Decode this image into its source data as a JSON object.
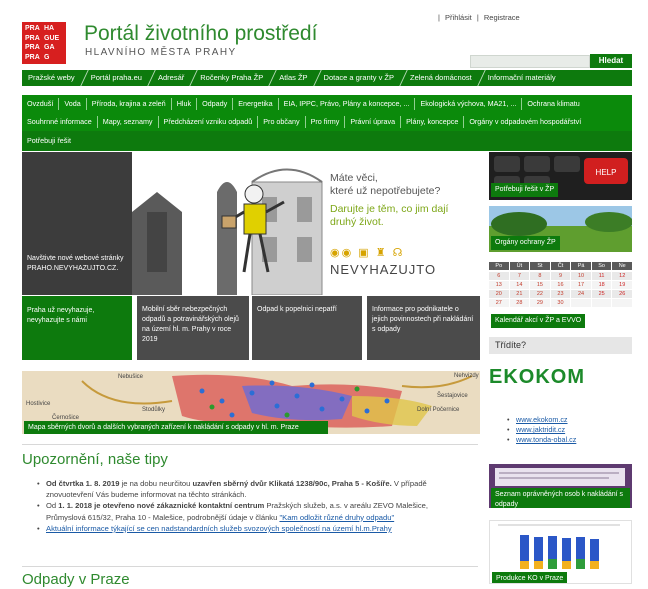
{
  "header": {
    "logo_lines": [
      "PRA",
      "HA",
      "PRA",
      "GUE",
      "PRA",
      "GA",
      "PRA",
      "G"
    ],
    "title": "Portál životního prostředí",
    "subtitle": "HLAVNÍHO MĚSTA PRAHY",
    "login": "Přihlásit",
    "register": "Registrace",
    "search_placeholder": "",
    "search_button": "Hledat"
  },
  "nav_top": [
    "Pražské weby",
    "Portál praha.eu",
    "Adresář",
    "Ročenky Praha ŽP",
    "Atlas ŽP",
    "Dotace a granty v ŽP",
    "Zelená domácnost",
    "Informační materiály"
  ],
  "nav_topics": [
    "Ovzduší",
    "Voda",
    "Příroda, krajina a zeleň",
    "Hluk",
    "Odpady",
    "Energetika",
    "EIA, IPPC, Právo, Plány a koncepce, ...",
    "Ekologická výchova, MA21, ...",
    "Ochrana klimatu"
  ],
  "nav_sub": [
    "Souhrnné informace",
    "Mapy, seznamy",
    "Předcházení vzniku odpadů",
    "Pro občany",
    "Pro firmy",
    "Právní úprava",
    "Plány, koncepce",
    "Orgány v odpadovém hospodářství"
  ],
  "nav_sub2": [
    "Potřebuji řešit"
  ],
  "hero": {
    "left_text": "Navštivte nové webové stránky PRAHO.NEVYHAZUJTO.CZ.",
    "q1": "Máte věci,",
    "q2": "které už nepotřebujete?",
    "g1": "Darujte je těm, co jim dají",
    "g2": "druhý život.",
    "brand": "NEVYHAZUJTO"
  },
  "tiles": [
    "Praha už nevyhazuje, nevyhazujte s námi",
    "Mobilní sběr nebezpečných odpadů a potravinářských olejů na území hl. m. Prahy v roce 2019",
    "Odpad k popelnici nepatří",
    "Informace pro podnikatele o jejich povinnostech při nakládání s odpady"
  ],
  "map_caption": "Mapa sběrných dvorů a dalších vybraných zařízení k nakládání s odpady v hl. m. Praze",
  "map_labels": [
    "Nebušice",
    "Nehvizdy",
    "Hostivice",
    "Dolní Počernice",
    "Šestajovice",
    "Stodůlky",
    "Černošice"
  ],
  "sidebar": {
    "card1": "Potřebuji řešit v ŽP",
    "card2": "Orgány ochrany ŽP",
    "calendar_head": [
      "Po",
      "Út",
      "St",
      "Čt",
      "Pá",
      "So",
      "Ne"
    ],
    "calendar_rows": [
      [
        "",
        "",
        "",
        "",
        "",
        "",
        ""
      ],
      [
        "6",
        "7",
        "8",
        "9",
        "10",
        "11",
        "12"
      ],
      [
        "13",
        "14",
        "15",
        "16",
        "17",
        "18",
        "19"
      ],
      [
        "20",
        "21",
        "22",
        "23",
        "24",
        "25",
        "26"
      ],
      [
        "27",
        "28",
        "29",
        "30",
        "",
        "",
        ""
      ]
    ],
    "calendar_caption": "Kalendář akcí v ŽP a EVVO",
    "tridite": "Třídíte?",
    "ekokom": "EKOKOM",
    "links": [
      "www.ekokom.cz",
      "www.jaktridit.cz",
      "www.tonda-obal.cz"
    ],
    "card3": "Seznam oprávněných osob k nakládání s odpady",
    "card4": "Produkce KO v Praze"
  },
  "notices": {
    "title": "Upozornění, naše tipy",
    "i1a": "Od čtvrtka 1. 8. 2019",
    "i1b": " je na dobu neurčitou ",
    "i1c": "uzavřen sběrný dvůr Klikatá 1238/90c, Praha 5 - Košíře.",
    "i1d": " V případě znovuotevření Vás budeme informovat na těchto stránkách.",
    "i2a": "Od ",
    "i2b": "1. 1. 2018 je otevřeno nové zákaznické kontaktní centrum",
    "i2c": " Pražských služeb, a.s. v areálu ZEVO Malešice, Průmyslová 615/32, Praha 10 - Malešice, podrobnější údaje v článku ",
    "i2d": "\"Kam odložit různé druhy odpadu\"",
    "i3": "Aktuální informace týkající se cen nadstandardních služeb svozových společností na území hl.m.Prahy",
    "title2": "Odpady v Praze"
  },
  "colors": {
    "green": "#0d7a0d",
    "red": "#d22b2b",
    "title_green": "#2f8a2f"
  }
}
